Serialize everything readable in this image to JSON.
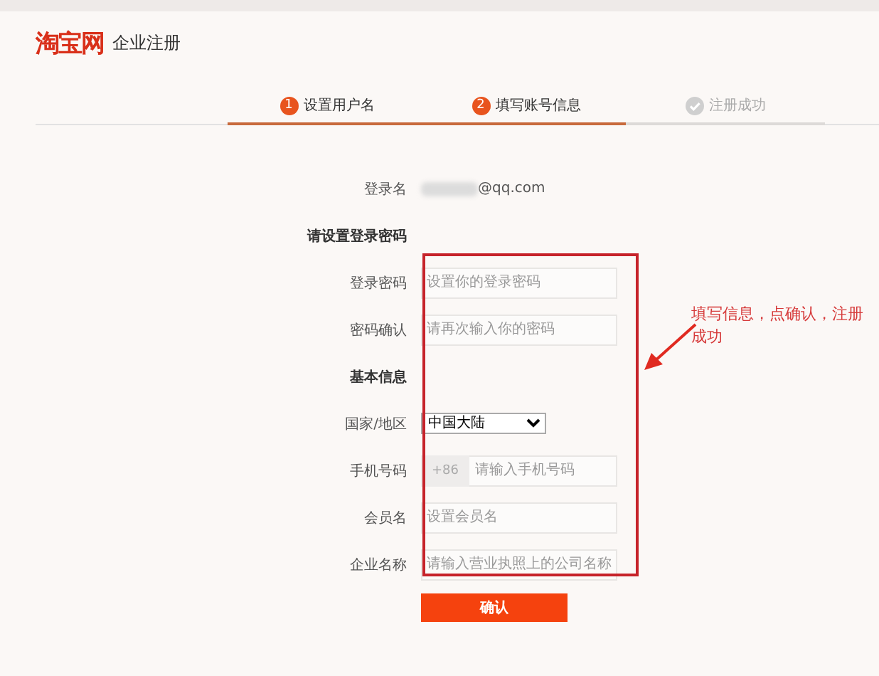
{
  "header": {
    "logo": "淘宝网",
    "title": "企业注册"
  },
  "steps": [
    {
      "number": "1",
      "label": "设置用户名",
      "active": true
    },
    {
      "number": "2",
      "label": "填写账号信息",
      "active": true
    },
    {
      "label": "注册成功",
      "active": false
    }
  ],
  "form": {
    "rows": [
      {
        "kind": "text",
        "label": "登录名",
        "value": "@qq.com",
        "blurred": true
      },
      {
        "kind": "heading",
        "label": "请设置登录密码"
      },
      {
        "kind": "input",
        "label": "登录密码",
        "placeholder": "设置你的登录密码"
      },
      {
        "kind": "input",
        "label": "密码确认",
        "placeholder": "请再次输入你的密码"
      },
      {
        "kind": "heading",
        "label": "基本信息"
      },
      {
        "kind": "select",
        "label": "国家/地区",
        "value": "中国大陆"
      },
      {
        "kind": "phone",
        "label": "手机号码",
        "prefix": "+86",
        "placeholder": "请输入手机号码"
      },
      {
        "kind": "input",
        "label": "会员名",
        "placeholder": "设置会员名"
      },
      {
        "kind": "input",
        "label": "企业名称",
        "placeholder": "请输入营业执照上的公司名称"
      }
    ],
    "submit": "确认"
  },
  "annotation": {
    "text": "填写信息，点确认，注册成功"
  }
}
